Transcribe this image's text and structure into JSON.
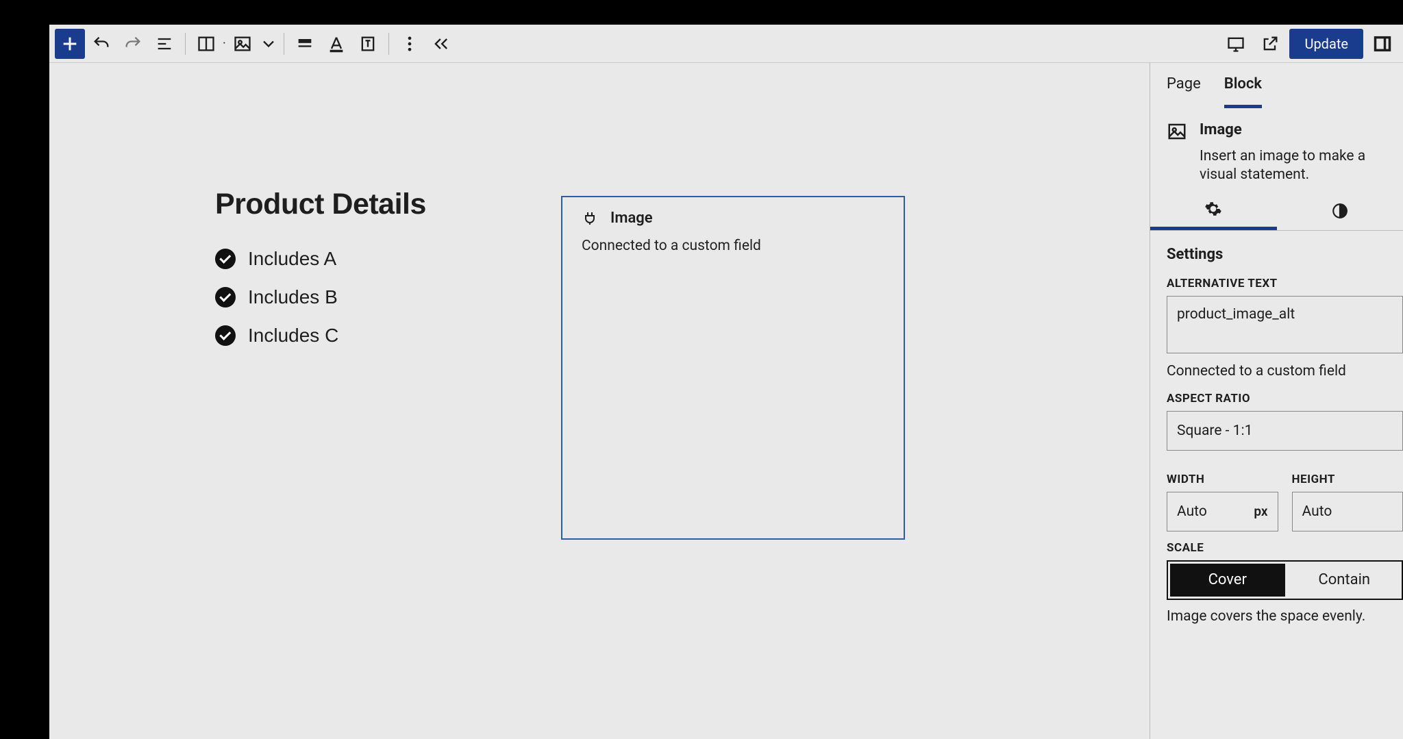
{
  "toolbar": {
    "update_label": "Update"
  },
  "canvas": {
    "heading": "Product Details",
    "list": [
      "Includes A",
      "Includes B",
      "Includes C"
    ],
    "image_block": {
      "title": "Image",
      "subtitle": "Connected to a custom field"
    }
  },
  "sidebar": {
    "tabs": {
      "page": "Page",
      "block": "Block",
      "active": "block"
    },
    "block_header": {
      "title": "Image",
      "description": "Insert an image to make a visual statement."
    },
    "settings": {
      "section_title": "Settings",
      "alt_label": "ALTERNATIVE TEXT",
      "alt_value": "product_image_alt",
      "alt_help": "Connected to a custom field",
      "aspect_label": "ASPECT RATIO",
      "aspect_value": "Square - 1:1",
      "width_label": "WIDTH",
      "width_value": "Auto",
      "width_unit": "px",
      "height_label": "HEIGHT",
      "height_value": "Auto",
      "scale_label": "SCALE",
      "scale_options": {
        "cover": "Cover",
        "contain": "Contain",
        "active": "cover"
      },
      "scale_help": "Image covers the space evenly."
    }
  }
}
